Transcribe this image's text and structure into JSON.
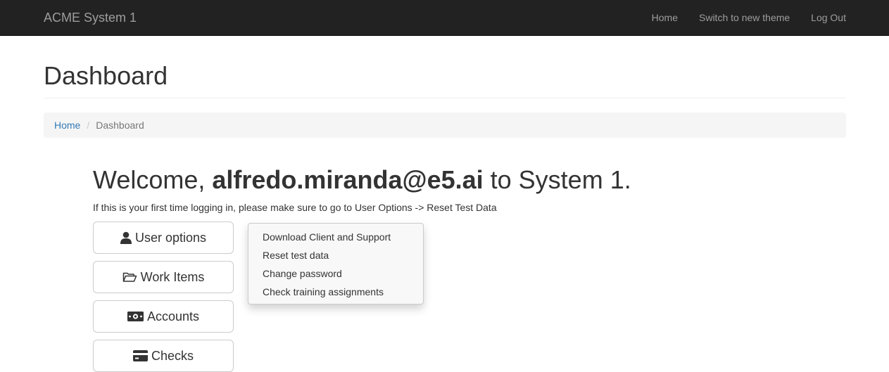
{
  "navbar": {
    "brand": "ACME System 1",
    "links": [
      "Home",
      "Switch to new theme",
      "Log Out"
    ]
  },
  "page": {
    "title": "Dashboard"
  },
  "breadcrumb": {
    "home": "Home",
    "separator": "/",
    "current": "Dashboard"
  },
  "welcome": {
    "prefix": "Welcome, ",
    "user": "alfredo.miranda@e5.ai",
    "suffix": " to System 1.",
    "hint": "If this is your first time logging in, please make sure to go to User Options -> Reset Test Data"
  },
  "buttons": [
    {
      "label": "User options",
      "icon": "user-icon"
    },
    {
      "label": "Work Items",
      "icon": "folder-open-icon"
    },
    {
      "label": "Accounts",
      "icon": "money-icon"
    },
    {
      "label": "Checks",
      "icon": "credit-card-icon"
    }
  ],
  "dropdown": {
    "items": [
      "Download Client and Support",
      "Reset test data",
      "Change password",
      "Check training assignments"
    ]
  }
}
